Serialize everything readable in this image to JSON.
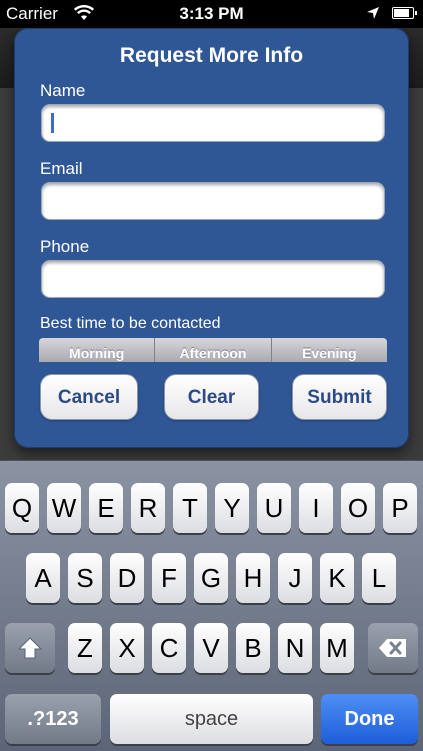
{
  "status_bar": {
    "carrier": "Carrier",
    "time": "3:13 PM",
    "wifi_icon": "wifi-icon",
    "location_icon": "location-arrow-icon",
    "battery_icon": "battery-icon"
  },
  "dialog": {
    "title": "Request More Info",
    "name_label": "Name",
    "name_value": "",
    "email_label": "Email",
    "email_value": "",
    "phone_label": "Phone",
    "phone_value": "",
    "contact_time_label": "Best time to be contacted",
    "contact_time_options": [
      "Morning",
      "Afternoon",
      "Evening"
    ],
    "cancel_label": "Cancel",
    "clear_label": "Clear",
    "submit_label": "Submit",
    "accent_color": "#2f5796"
  },
  "keyboard": {
    "row1": [
      "Q",
      "W",
      "E",
      "R",
      "T",
      "Y",
      "U",
      "I",
      "O",
      "P"
    ],
    "row2": [
      "A",
      "S",
      "D",
      "F",
      "G",
      "H",
      "J",
      "K",
      "L"
    ],
    "row3": [
      "Z",
      "X",
      "C",
      "V",
      "B",
      "N",
      "M"
    ],
    "numbers_label": ".?123",
    "space_label": "space",
    "done_label": "Done",
    "shift_icon": "shift-arrow-icon",
    "delete_icon": "backspace-icon",
    "done_color": "#1d5ed9"
  }
}
